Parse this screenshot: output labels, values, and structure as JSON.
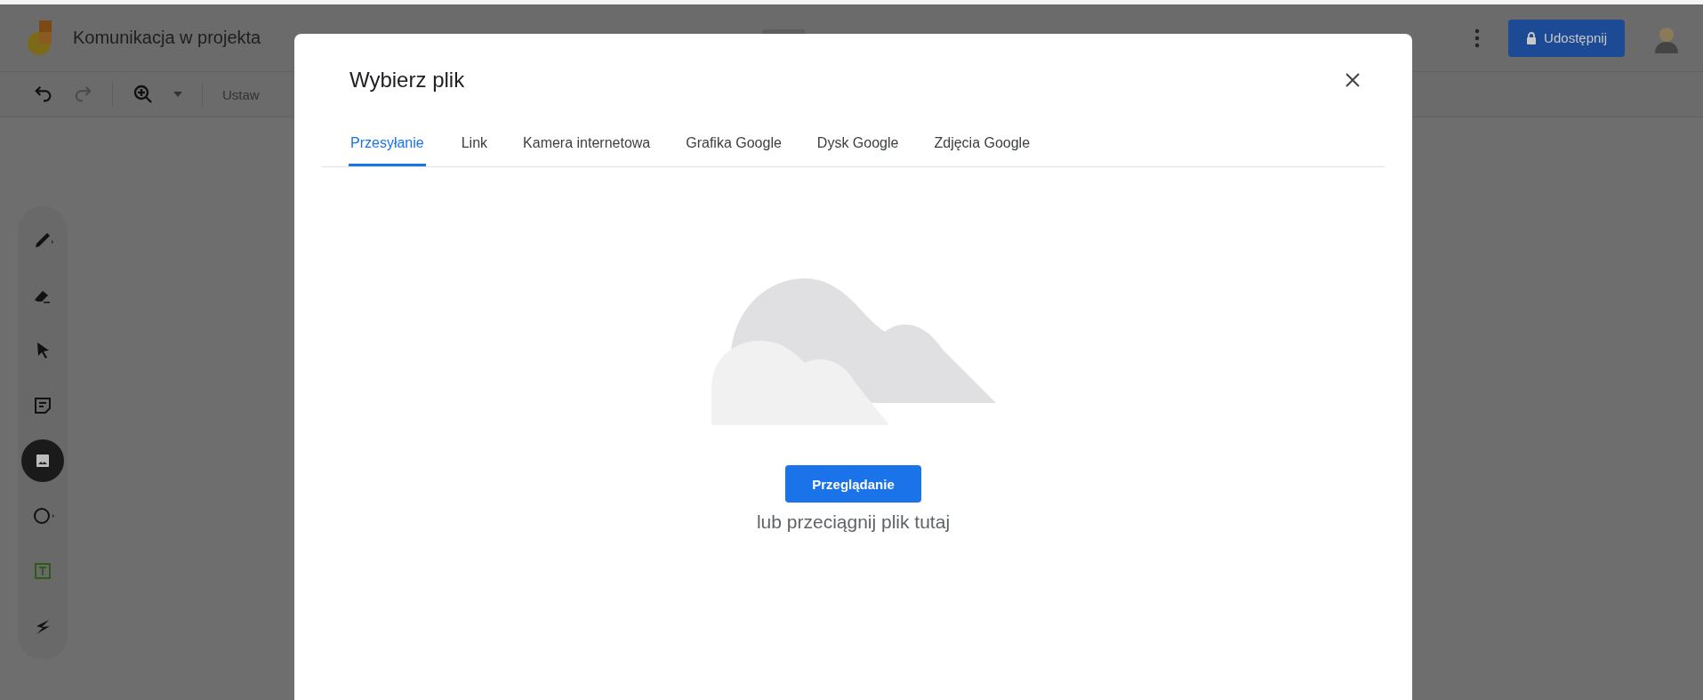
{
  "header": {
    "title": "Komunikacja w projekta",
    "share_button": "Udostępnij"
  },
  "toolbar": {
    "zoom_label": "Ustaw"
  },
  "tools": [
    {
      "kind": "pen",
      "selected": false
    },
    {
      "kind": "eraser",
      "selected": false
    },
    {
      "kind": "pointer",
      "selected": false
    },
    {
      "kind": "note",
      "selected": false
    },
    {
      "kind": "image",
      "selected": true
    },
    {
      "kind": "circle",
      "selected": false
    },
    {
      "kind": "textbox",
      "selected": false
    },
    {
      "kind": "laser",
      "selected": false
    }
  ],
  "dialog": {
    "title": "Wybierz plik",
    "tabs": [
      {
        "label": "Przesyłanie",
        "selected": true
      },
      {
        "label": "Link",
        "selected": false
      },
      {
        "label": "Kamera internetowa",
        "selected": false
      },
      {
        "label": "Grafika Google",
        "selected": false
      },
      {
        "label": "Dysk Google",
        "selected": false
      },
      {
        "label": "Zdjęcia Google",
        "selected": false
      }
    ],
    "browse_button": "Przeglądanie",
    "drop_hint": "lub przeciągnij plik tutaj"
  }
}
